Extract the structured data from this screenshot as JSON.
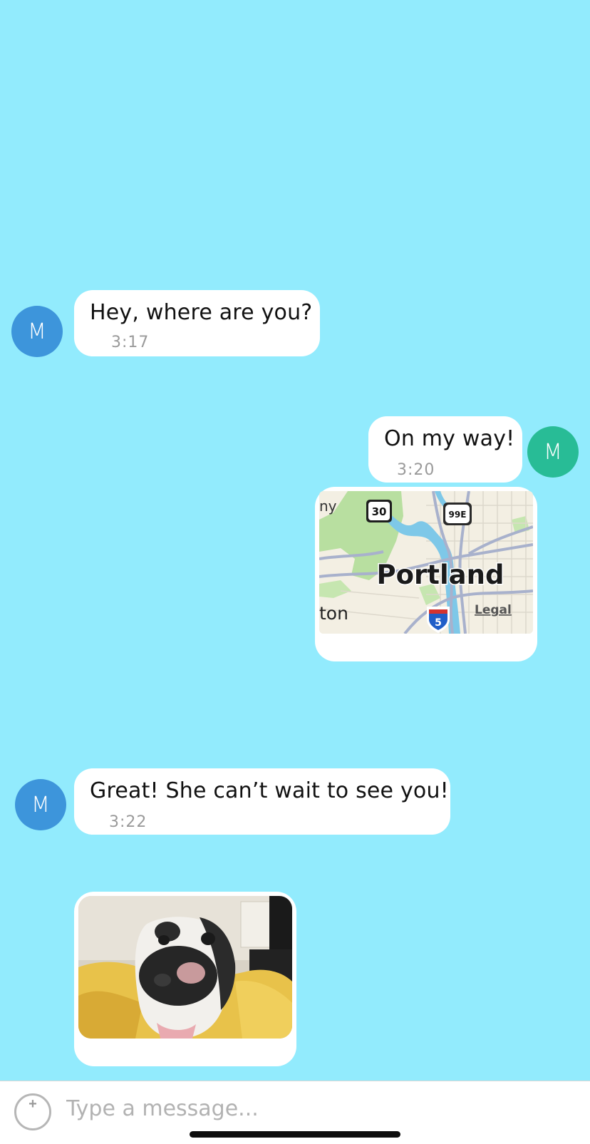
{
  "colors": {
    "background": "#92ebfd",
    "bubble": "#ffffff",
    "avatar_blue": "#3d95db",
    "avatar_green": "#28bc96"
  },
  "messages": [
    {
      "avatar": "M",
      "text": "Hey, where are you?",
      "time": "3:17"
    },
    {
      "avatar": "M",
      "text": "On my way!",
      "time": "3:20"
    },
    {
      "avatar": "M",
      "text": "Great! She can’t wait to see you!",
      "time": "3:22"
    }
  ],
  "map": {
    "city": "Portland",
    "partial_left_top": "ny",
    "partial_left_bottom": "ton",
    "shield_us": "30",
    "shield_or": "99E",
    "shield_i": "5",
    "legal": "Legal"
  },
  "photo": {
    "subject": "dog-photo"
  },
  "composer": {
    "add_icon": "plus-circle-icon",
    "placeholder": "Type a message..."
  }
}
